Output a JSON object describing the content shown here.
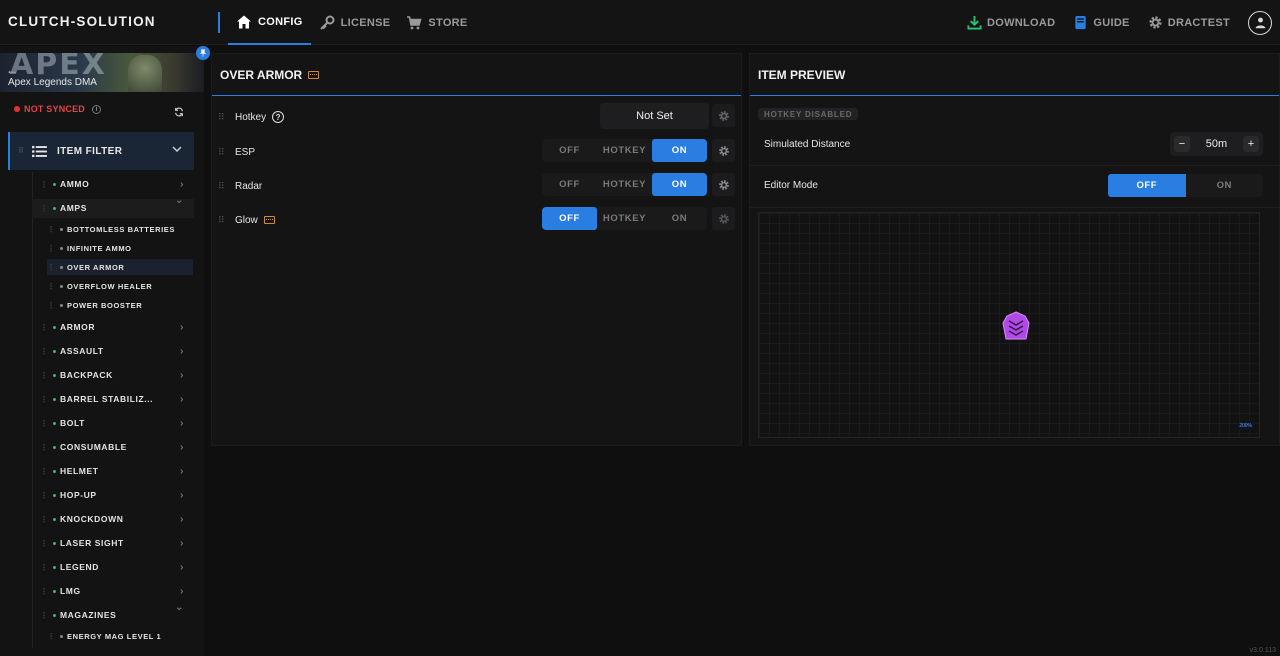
{
  "brand": "CLUTCH-SOLUTION",
  "nav": {
    "config": "CONFIG",
    "license": "LICENSE",
    "store": "STORE",
    "download": "DOWNLOAD",
    "guide": "GUIDE",
    "user": "DRACTEST"
  },
  "sidebar": {
    "game_logo": "APEX",
    "game_title": "Apex Legends DMA",
    "sync_status": "NOT SYNCED",
    "filter_title": "ITEM FILTER",
    "items": [
      {
        "label": "AMMO",
        "expanded": false
      },
      {
        "label": "AMPS",
        "expanded": true
      },
      {
        "label": "ARMOR",
        "expanded": false
      },
      {
        "label": "ASSAULT",
        "expanded": false
      },
      {
        "label": "BACKPACK",
        "expanded": false
      },
      {
        "label": "BARREL STABILIZ...",
        "expanded": false
      },
      {
        "label": "BOLT",
        "expanded": false
      },
      {
        "label": "CONSUMABLE",
        "expanded": false
      },
      {
        "label": "HELMET",
        "expanded": false
      },
      {
        "label": "HOP-UP",
        "expanded": false
      },
      {
        "label": "KNOCKDOWN",
        "expanded": false
      },
      {
        "label": "LASER SIGHT",
        "expanded": false
      },
      {
        "label": "LEGEND",
        "expanded": false
      },
      {
        "label": "LMG",
        "expanded": false
      },
      {
        "label": "MAGAZINES",
        "expanded": true
      }
    ],
    "amps_children": [
      "BOTTOMLESS BATTERIES",
      "INFINITE AMMO",
      "OVER ARMOR",
      "OVERFLOW HEALER",
      "POWER BOOSTER"
    ],
    "magazines_children": [
      "ENERGY MAG LEVEL 1"
    ],
    "selected": "OVER ARMOR"
  },
  "settings": {
    "title": "OVER ARMOR",
    "hotkey_label": "Hotkey",
    "hotkey_value": "Not Set",
    "options": [
      "OFF",
      "HOTKEY",
      "ON"
    ],
    "rows": [
      {
        "label": "ESP",
        "state": "ON"
      },
      {
        "label": "Radar",
        "state": "ON"
      },
      {
        "label": "Glow",
        "state": "OFF"
      }
    ]
  },
  "preview": {
    "title": "ITEM PREVIEW",
    "hotkey_badge": "HOTKEY DISABLED",
    "distance_label": "Simulated Distance",
    "distance_value": "50m",
    "minus": "−",
    "plus": "+",
    "editor_label": "Editor Mode",
    "editor_off": "OFF",
    "editor_on": "ON",
    "editor_state": "OFF",
    "scale_tag": "200%"
  },
  "version": "v3.0.113",
  "colors": {
    "accent": "#2a7de1",
    "item": "#b04ae6",
    "unsynced": "#e8302f",
    "active_dot": "#2fbf71"
  }
}
